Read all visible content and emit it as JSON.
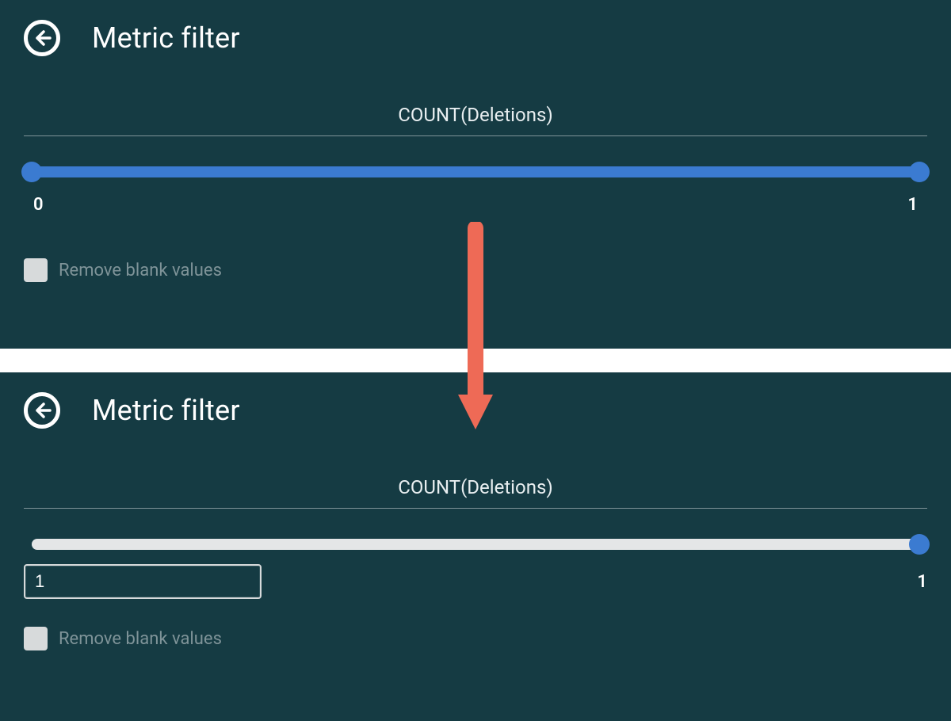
{
  "colors": {
    "panel_bg": "#153b43",
    "accent_blue": "#3b7bd1",
    "track_grey": "#e4e6e7",
    "arrow": "#ee6a56",
    "text_muted": "#7e9398"
  },
  "top": {
    "title": "Metric filter",
    "metric_label": "COUNT(Deletions)",
    "slider": {
      "min_label": "0",
      "max_label": "1"
    },
    "checkbox_label": "Remove blank values",
    "checkbox_checked": false
  },
  "bottom": {
    "title": "Metric filter",
    "metric_label": "COUNT(Deletions)",
    "slider_right_label": "1",
    "input_value": "1",
    "checkbox_label": "Remove blank values",
    "checkbox_checked": false
  }
}
